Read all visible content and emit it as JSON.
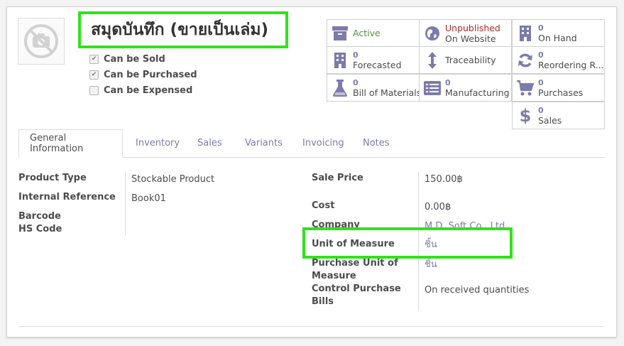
{
  "product": {
    "name": "สมุดบันทึก (ขายเป็นเล่ม)",
    "image_icon": "camera-off-icon"
  },
  "options": [
    {
      "label": "Can be Sold",
      "checked": true
    },
    {
      "label": "Can be Purchased",
      "checked": true
    },
    {
      "label": "Can be Expensed",
      "checked": false
    }
  ],
  "stat_buttons": {
    "active": {
      "label": "Active",
      "color": "#4a8f3a",
      "icon": "archive-icon"
    },
    "website": {
      "line1": "Unpublished",
      "line2": "On Website",
      "color": "#a52a2a",
      "icon": "globe-icon"
    },
    "on_hand": {
      "value": "0",
      "label": "On Hand",
      "icon": "building-icon"
    },
    "forecasted": {
      "value": "0",
      "label": "Forecasted",
      "icon": "building-icon"
    },
    "traceability": {
      "label": "Traceability",
      "icon": "arrows-vertical-icon"
    },
    "reordering": {
      "value": "0",
      "label": "Reordering R...",
      "icon": "refresh-icon"
    },
    "bom": {
      "value": "0",
      "label": "Bill of Materials",
      "icon": "flask-icon"
    },
    "manufacturing": {
      "value": "0",
      "label": "Manufacturing",
      "icon": "list-icon"
    },
    "purchases": {
      "value": "0",
      "label": "Purchases",
      "icon": "cart-icon"
    },
    "sales": {
      "value": "0",
      "label": "Sales",
      "icon": "dollar-icon"
    }
  },
  "tabs": [
    "General Information",
    "Inventory",
    "Sales",
    "Variants",
    "Invoicing",
    "Notes"
  ],
  "active_tab": "General Information",
  "fields_left": {
    "product_type": {
      "label": "Product Type",
      "value": "Stockable Product"
    },
    "internal_reference": {
      "label": "Internal Reference",
      "value": "Book01"
    },
    "barcode": {
      "label": "Barcode",
      "value": ""
    },
    "hs_code": {
      "label": "HS Code",
      "value": ""
    }
  },
  "fields_right": {
    "sale_price": {
      "label": "Sale Price",
      "value": "150.00฿"
    },
    "cost": {
      "label": "Cost",
      "value": "0.00฿"
    },
    "company": {
      "label": "Company",
      "value": "M.D. Soft Co., Ltd."
    },
    "uom": {
      "label": "Unit of Measure",
      "value": "ชิ้น"
    },
    "purchase_uom": {
      "label_line1": "Purchase Unit of",
      "label_line2": "Measure",
      "value": "ชิ้น"
    },
    "control_policy": {
      "label_line1": "Control Purchase",
      "label_line2": "Bills",
      "value": "On received quantities"
    }
  },
  "colors": {
    "accent": "#7c7bad",
    "highlight": "#30e21b"
  }
}
